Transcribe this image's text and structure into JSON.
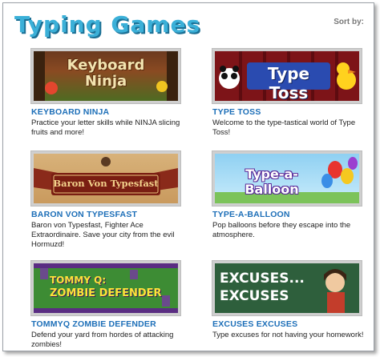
{
  "page": {
    "title": "Typing Games",
    "sort_label": "Sort by:"
  },
  "games": [
    {
      "name": "KEYBOARD NINJA",
      "description": "Practice your letter skills while NINJA slicing fruits and more!",
      "logo_text": "Keyboard Ninja"
    },
    {
      "name": "TYPE TOSS",
      "description": "Welcome to the type-tastical world of Type Toss!",
      "logo_text": "Type Toss"
    },
    {
      "name": "BARON VON TYPESFAST",
      "description": "Baron von Typesfast, Fighter Ace Extraordinaire. Save your city from the evil Hormuzd!",
      "logo_text": "Baron Von Typesfast"
    },
    {
      "name": "TYPE-A-BALLOON",
      "description": "Pop balloons before they escape into the atmosphere.",
      "logo_text": "Type-a-Balloon"
    },
    {
      "name": "TOMMYQ ZOMBIE DEFENDER",
      "description": "Defend your yard from hordes of attacking zombies!",
      "logo_text_1": "TOMMY Q:",
      "logo_text_2": "ZOMBIE DEFENDER"
    },
    {
      "name": "EXCUSES EXCUSES",
      "description": "Type excuses for not having your homework!",
      "logo_text": "EXCUSES... EXCUSES"
    }
  ]
}
